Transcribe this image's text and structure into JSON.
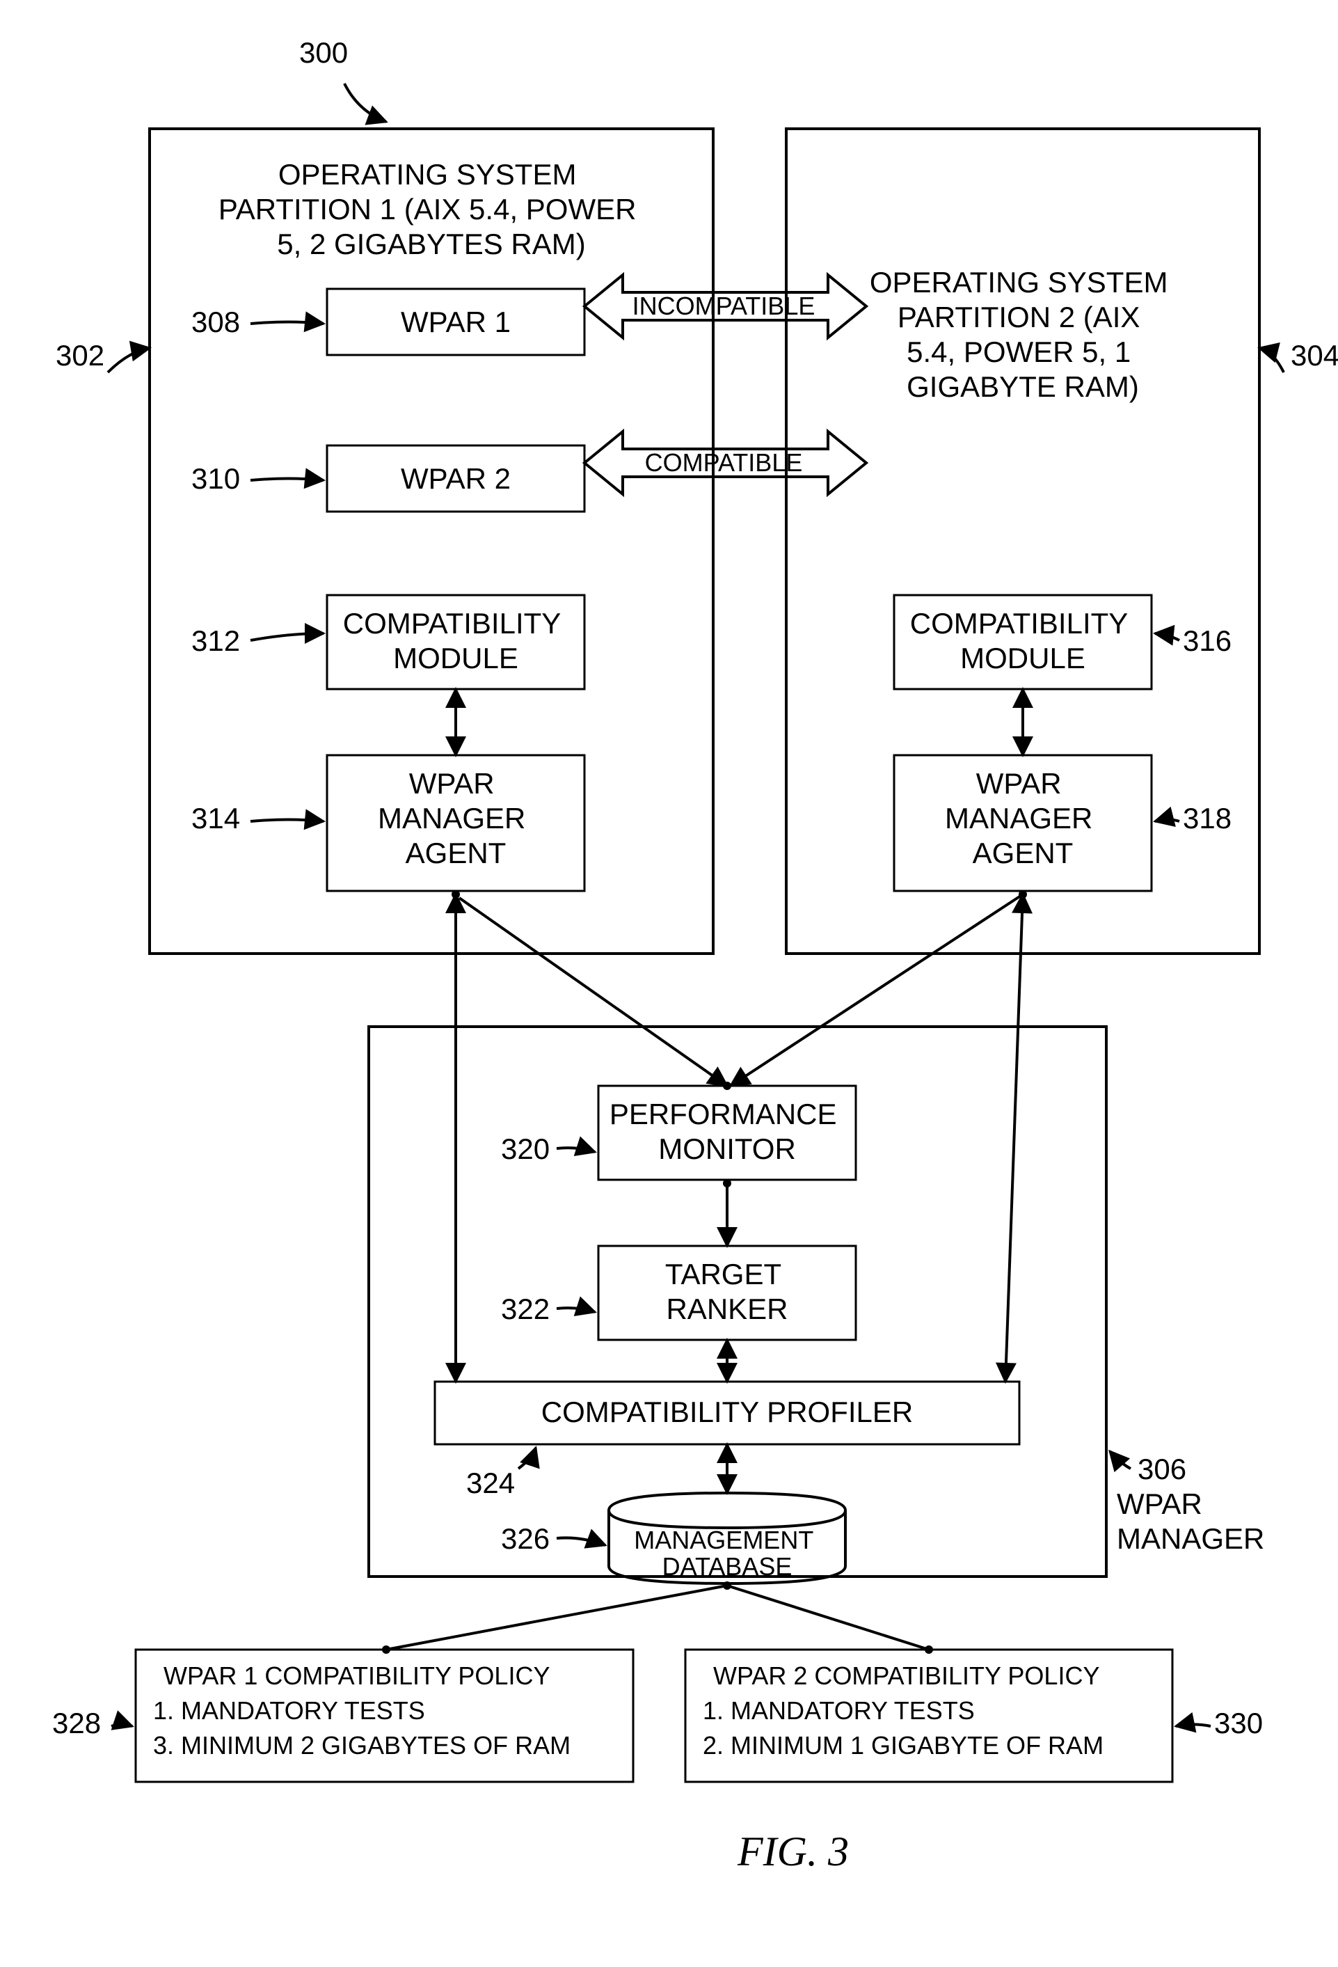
{
  "figure": {
    "num": "300",
    "caption": "FIG. 3"
  },
  "partition1": {
    "ref": "302",
    "title": [
      "OPERATING SYSTEM",
      "PARTITION 1 (AIX 5.4, POWER",
      "5, 2 GIGABYTES RAM)"
    ],
    "wpar1": {
      "ref": "308",
      "label": "WPAR 1"
    },
    "wpar2": {
      "ref": "310",
      "label": "WPAR 2"
    },
    "compat": {
      "ref": "312",
      "label": [
        "COMPATIBILITY",
        "MODULE"
      ]
    },
    "agent": {
      "ref": "314",
      "label": [
        "WPAR",
        "MANAGER",
        "AGENT"
      ]
    }
  },
  "partition2": {
    "ref": "304",
    "title": [
      "OPERATING SYSTEM",
      "PARTITION 2 (AIX",
      "5.4, POWER 5, 1",
      "GIGABYTE RAM)"
    ],
    "compat": {
      "ref": "316",
      "label": [
        "COMPATIBILITY",
        "MODULE"
      ]
    },
    "agent": {
      "ref": "318",
      "label": [
        "WPAR",
        "MANAGER",
        "AGENT"
      ]
    }
  },
  "arrow1": "INCOMPATIBLE",
  "arrow2": "COMPATIBLE",
  "manager": {
    "ref": "306",
    "caption": [
      "WPAR",
      "MANAGER"
    ],
    "perf": {
      "ref": "320",
      "label": [
        "PERFORMANCE",
        "MONITOR"
      ]
    },
    "ranker": {
      "ref": "322",
      "label": [
        "TARGET",
        "RANKER"
      ]
    },
    "profiler": {
      "ref": "324",
      "label": "COMPATIBILITY PROFILER"
    },
    "db": {
      "ref": "326",
      "label": [
        "MANAGEMENT",
        "DATABASE"
      ]
    }
  },
  "policy1": {
    "ref": "328",
    "lines": [
      "WPAR 1 COMPATIBILITY POLICY",
      "1. MANDATORY TESTS",
      "3. MINIMUM 2 GIGABYTES OF RAM"
    ]
  },
  "policy2": {
    "ref": "330",
    "lines": [
      "WPAR 2 COMPATIBILITY POLICY",
      "1. MANDATORY TESTS",
      "2. MINIMUM 1 GIGABYTE OF RAM"
    ]
  }
}
